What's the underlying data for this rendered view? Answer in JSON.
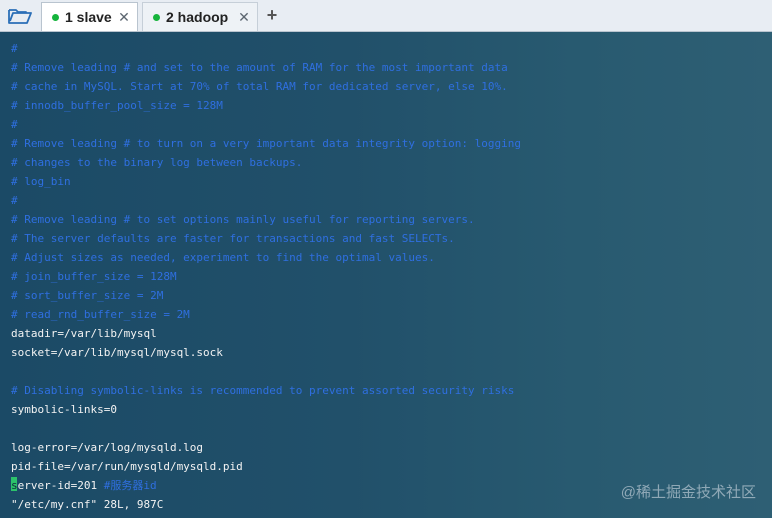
{
  "tabs": [
    {
      "label": "1 slave",
      "active": true,
      "status_color": "#16b43c",
      "close": "✕"
    },
    {
      "label": "2 hadoop",
      "active": false,
      "status_color": "#16b43c",
      "close": "✕"
    }
  ],
  "add_tab_label": "+",
  "colors": {
    "comment": "#2f6fe0",
    "text": "#f3f3f3",
    "cursor": "#2cc36b"
  },
  "lines": [
    {
      "text": "#",
      "kind": "comment"
    },
    {
      "text": "# Remove leading # and set to the amount of RAM for the most important data",
      "kind": "comment"
    },
    {
      "text": "# cache in MySQL. Start at 70% of total RAM for dedicated server, else 10%.",
      "kind": "comment"
    },
    {
      "text": "# innodb_buffer_pool_size = 128M",
      "kind": "comment"
    },
    {
      "text": "#",
      "kind": "comment"
    },
    {
      "text": "# Remove leading # to turn on a very important data integrity option: logging",
      "kind": "comment"
    },
    {
      "text": "# changes to the binary log between backups.",
      "kind": "comment"
    },
    {
      "text": "# log_bin",
      "kind": "comment"
    },
    {
      "text": "#",
      "kind": "comment"
    },
    {
      "text": "# Remove leading # to set options mainly useful for reporting servers.",
      "kind": "comment"
    },
    {
      "text": "# The server defaults are faster for transactions and fast SELECTs.",
      "kind": "comment"
    },
    {
      "text": "# Adjust sizes as needed, experiment to find the optimal values.",
      "kind": "comment"
    },
    {
      "text": "# join_buffer_size = 128M",
      "kind": "comment"
    },
    {
      "text": "# sort_buffer_size = 2M",
      "kind": "comment"
    },
    {
      "text": "# read_rnd_buffer_size = 2M",
      "kind": "comment"
    },
    {
      "text": "datadir=/var/lib/mysql",
      "kind": "plain"
    },
    {
      "text": "socket=/var/lib/mysql/mysql.sock",
      "kind": "plain"
    },
    {
      "text": "",
      "kind": "plain"
    },
    {
      "text": "# Disabling symbolic-links is recommended to prevent assorted security risks",
      "kind": "comment"
    },
    {
      "text": "symbolic-links=0",
      "kind": "plain"
    },
    {
      "text": "",
      "kind": "plain"
    },
    {
      "text": "log-error=/var/log/mysqld.log",
      "kind": "plain"
    },
    {
      "text": "pid-file=/var/run/mysqld/mysqld.pid",
      "kind": "plain"
    }
  ],
  "cursor_line": {
    "cursor_char": "s",
    "text": "erver-id=201 ",
    "comment": "#服务器id"
  },
  "status_line": "\"/etc/my.cnf\" 28L, 987C",
  "watermark": "@稀土掘金技术社区"
}
